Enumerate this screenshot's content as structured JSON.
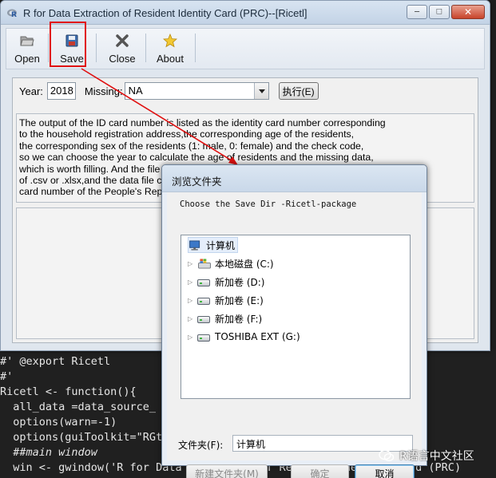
{
  "window": {
    "title": "R for Data Extraction of Resident Identity Card (PRC)--[Ricetl]",
    "minimize_glyph": "–",
    "maximize_glyph": "□",
    "close_glyph": "✕"
  },
  "toolbar": {
    "open_label": "Open",
    "save_label": "Save",
    "close_label": "Close",
    "about_label": "About"
  },
  "form": {
    "year_label": "Year:",
    "year_value": "2018",
    "missing_label": "Missing:",
    "missing_value": "NA",
    "run_label": "执行(E)"
  },
  "description": {
    "lines": [
      "The output of the ID card number is listed as the identity card number corresponding",
      "to the household registration address,the corresponding age of the residents,",
      "the corresponding sex of the residents (1: male, 0: female) and the check code,",
      "so we can choose the year to calculate the age of residents and the missing data,",
      "which is worth filling. And the file you open should be a data file with a suffix",
      "of .csv or .xlsx,and the data file contains only one column of data, the identity",
      "card number of the People's Republic of China."
    ]
  },
  "code": {
    "lines": [
      "#' @export Ricetl",
      "#'",
      "Ricetl <- function(){",
      "  all_data =data_source_",
      "  options(warn=-1)",
      "  options(guiToolkit=\"RGtk2\")",
      "  ##main window",
      "  win <- gwindow('R for Data Extraction of Resident Identity Card (PRC)"
    ]
  },
  "dialog": {
    "title": "浏览文件夹",
    "instruction": "Choose the Save Dir -Ricetl-package",
    "tree": {
      "root": "计算机",
      "drives": [
        "本地磁盘 (C:)",
        "新加卷 (D:)",
        "新加卷 (E:)",
        "新加卷 (F:)",
        "TOSHIBA EXT (G:)"
      ]
    },
    "folder_label": "文件夹(F):",
    "folder_value": "计算机",
    "new_folder_label": "新建文件夹(M)",
    "ok_label": "确定",
    "cancel_label": "取消"
  },
  "watermark": {
    "text": "R语言中文社区"
  },
  "colors": {
    "highlight_box": "#e01010",
    "code_comment": "#d28a3c",
    "code_string": "#7fbf62",
    "code_keyword": "#e0c04a"
  }
}
